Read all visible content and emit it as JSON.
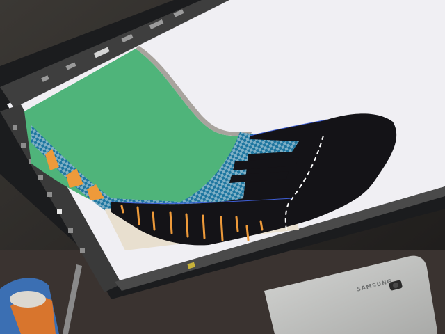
{
  "scene": {
    "description_kind": "photo-of-monitor-with-vector-art",
    "colors": {
      "background_wall": "#2a2624",
      "monitor_bezel": "#1b1c1e",
      "canvas_white": "#f0eff3",
      "green_field": "#4fb47a",
      "checker_light": "#7fb0c6",
      "checker_dark": "#1e76a0",
      "shoe_black": "#141317",
      "orange_accent": "#ee9a3a",
      "sole_beige": "#e8dfcf",
      "ui_panel": "#3e3e3e",
      "phone_silver": "#c8c9c7"
    },
    "phone": {
      "brand_label": "SAMSUNG"
    },
    "icons": [
      "toolbar-tool-icons",
      "camera-icon"
    ]
  }
}
